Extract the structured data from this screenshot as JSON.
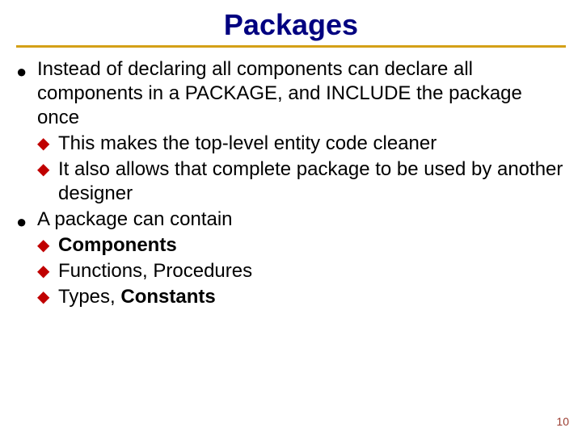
{
  "title": "Packages",
  "bullets": {
    "b1": "Instead of declaring all components can declare all components in a PACKAGE, and INCLUDE the package once",
    "b1a": "This makes the top-level entity code cleaner",
    "b1b": "It also allows that complete package to be used by another designer",
    "b2": "A package can contain",
    "b2a": "Components",
    "b2b": "Functions, Procedures",
    "b2c_pre": "Types, ",
    "b2c_bold": "Constants"
  },
  "page_number": "10"
}
